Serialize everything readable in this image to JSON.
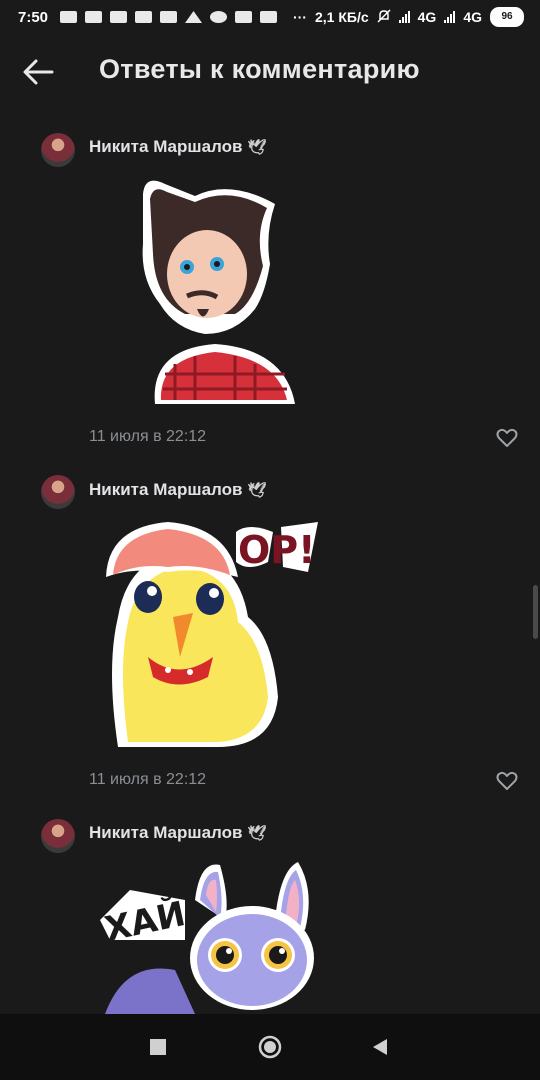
{
  "status": {
    "time": "7:50",
    "speed": "2,1 КБ/с",
    "net1": "4G",
    "net2": "4G",
    "battery": "96",
    "dots": "···"
  },
  "header": {
    "title": "Ответы к комментарию"
  },
  "comments": [
    {
      "author": "Никита Маршалов",
      "sticker": "Sticker: man in plaid shirt with cat ears",
      "time": "11 июля в 22:12"
    },
    {
      "author": "Никита Маршалов",
      "sticker": "Sticker: chick with egg shell hat",
      "sticker_text": "OP!",
      "time": "11 июля в 22:12"
    },
    {
      "author": "Никита Маршалов",
      "sticker": "Sticker: waving bat",
      "sticker_text": "ХАЙ"
    }
  ],
  "colors": {
    "background": "#1a1a1a",
    "navbar": "#0f0f0f",
    "text": "#e1e3e6",
    "muted": "#8b8f94"
  }
}
